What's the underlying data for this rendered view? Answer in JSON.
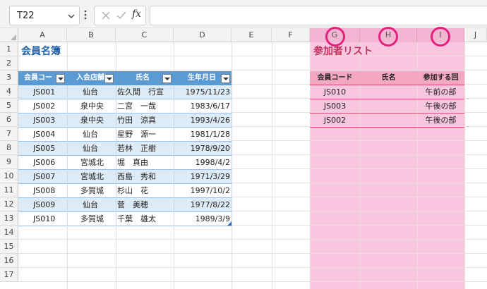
{
  "formula_bar": {
    "name_box": "T22",
    "formula": ""
  },
  "columns": [
    "A",
    "B",
    "C",
    "D",
    "E",
    "F",
    "G",
    "H",
    "I",
    "J"
  ],
  "rows": [
    "1",
    "2",
    "3",
    "4",
    "5",
    "6",
    "7",
    "8",
    "9",
    "10",
    "11",
    "12",
    "13",
    "14",
    "15",
    "16",
    "17"
  ],
  "titles": {
    "member_list": "会員名簿",
    "participant_list": "参加者リスト"
  },
  "members": {
    "headers": [
      "会員コー",
      "入会店舗",
      "氏名",
      "生年月日"
    ],
    "rows": [
      {
        "code": "JS001",
        "store": "仙台",
        "name": "佐久間　行宣",
        "birth": "1975/11/23"
      },
      {
        "code": "JS002",
        "store": "泉中央",
        "name": "二宮　一哉",
        "birth": "1983/6/17"
      },
      {
        "code": "JS003",
        "store": "泉中央",
        "name": "竹田　涼真",
        "birth": "1993/4/26"
      },
      {
        "code": "JS004",
        "store": "仙台",
        "name": "星野　源一",
        "birth": "1981/1/28"
      },
      {
        "code": "JS005",
        "store": "仙台",
        "name": "若林　正樹",
        "birth": "1978/9/20"
      },
      {
        "code": "JS006",
        "store": "宮城北",
        "name": "堀　真由",
        "birth": "1998/4/2"
      },
      {
        "code": "JS007",
        "store": "宮城北",
        "name": "西島　秀和",
        "birth": "1971/3/29"
      },
      {
        "code": "JS008",
        "store": "多賀城",
        "name": "杉山　花",
        "birth": "1997/10/2"
      },
      {
        "code": "JS009",
        "store": "仙台",
        "name": "菅　美穂",
        "birth": "1977/8/22"
      },
      {
        "code": "JS010",
        "store": "多賀城",
        "name": "千葉　雄太",
        "birth": "1989/3/9"
      }
    ]
  },
  "participants": {
    "headers": [
      "会員コード",
      "氏名",
      "参加する回"
    ],
    "rows": [
      {
        "code": "JS010",
        "name": "",
        "session": "午前の部"
      },
      {
        "code": "JS003",
        "name": "",
        "session": "午後の部"
      },
      {
        "code": "JS002",
        "name": "",
        "session": "午後の部"
      }
    ]
  },
  "highlighted_columns": [
    "G",
    "H",
    "I"
  ],
  "colors": {
    "table_header": "#5b9bd5",
    "table_band": "#ddebf7",
    "highlight_band": "#f9c6df",
    "ring": "#e6217d",
    "participant_title": "#c0355d"
  }
}
